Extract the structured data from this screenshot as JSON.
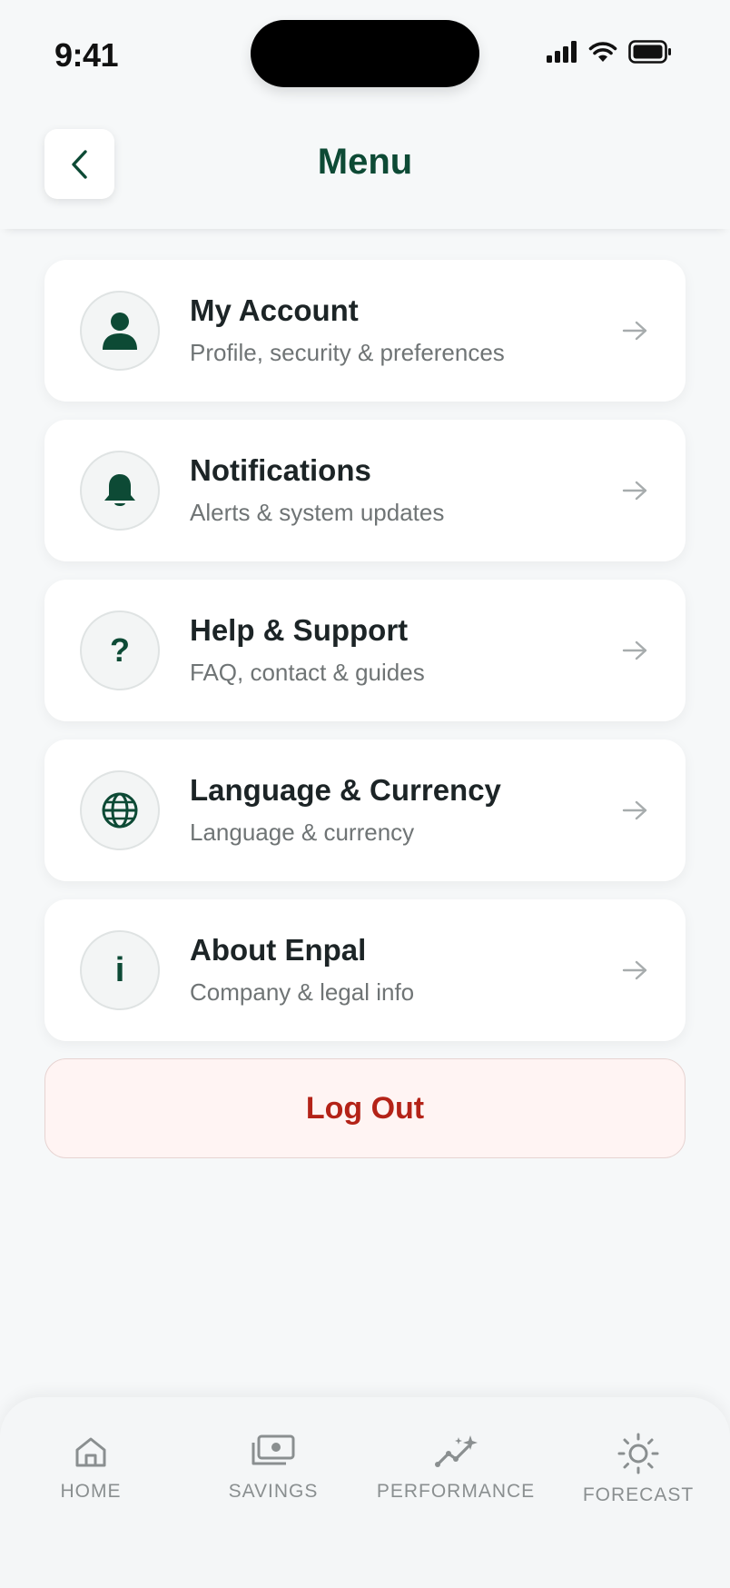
{
  "status_bar": {
    "time": "9:41"
  },
  "header": {
    "title": "Menu"
  },
  "menu": {
    "items": [
      {
        "title": "My Account",
        "subtitle": "Profile, security & preferences",
        "icon": "person-icon"
      },
      {
        "title": "Notifications",
        "subtitle": "Alerts & system updates",
        "icon": "bell-icon"
      },
      {
        "title": "Help & Support",
        "subtitle": "FAQ, contact & guides",
        "icon": "question-icon"
      },
      {
        "title": "Language & Currency",
        "subtitle": "Language & currency",
        "icon": "globe-icon"
      },
      {
        "title": "About Enpal",
        "subtitle": "Company & legal info",
        "icon": "info-icon"
      }
    ],
    "question_glyph": "?",
    "info_glyph": "i"
  },
  "logout": {
    "label": "Log Out"
  },
  "tab_bar": {
    "tabs": [
      {
        "label": "HOME",
        "icon": "home-icon"
      },
      {
        "label": "SAVINGS",
        "icon": "money-icon"
      },
      {
        "label": "PERFORMANCE",
        "icon": "sparkle-chart-icon"
      },
      {
        "label": "FORECAST",
        "icon": "sun-icon"
      }
    ]
  },
  "colors": {
    "brand_green": "#0d4a35",
    "logout_red": "#b42318",
    "logout_bg": "#fff4f3",
    "background": "#f6f8f9"
  }
}
